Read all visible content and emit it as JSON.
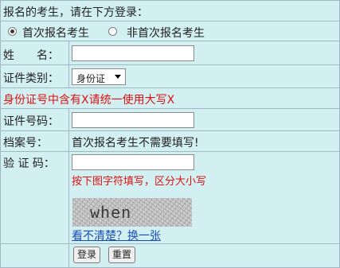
{
  "header": {
    "prompt": "报名的考生，请在下方登录："
  },
  "applicant_type": {
    "options": [
      {
        "label": "首次报名考生",
        "selected": true
      },
      {
        "label": "非首次报名考生",
        "selected": false
      }
    ]
  },
  "fields": {
    "name_label": "姓　　名：",
    "name_value": "",
    "id_type_label": "证件类别：",
    "id_type_selected": "身份证",
    "id_notice": "身份证号中含有X请统一使用大写X",
    "id_number_label": "证件号码：",
    "id_number_value": "",
    "archive_label": "档案号：",
    "archive_note": "首次报名考生不需要填写!",
    "captcha_label": "验 证 码：",
    "captcha_value": "",
    "captcha_hint": "按下图字符填写，区分大小写",
    "captcha_text": "when",
    "captcha_refresh": "看不清楚？换一张"
  },
  "buttons": {
    "login": "登录",
    "reset": "重置"
  },
  "colors": {
    "panel_bg": "#d2eff2",
    "border": "#9fb8c4",
    "notice": "#e01111",
    "link": "#1a4db3"
  }
}
